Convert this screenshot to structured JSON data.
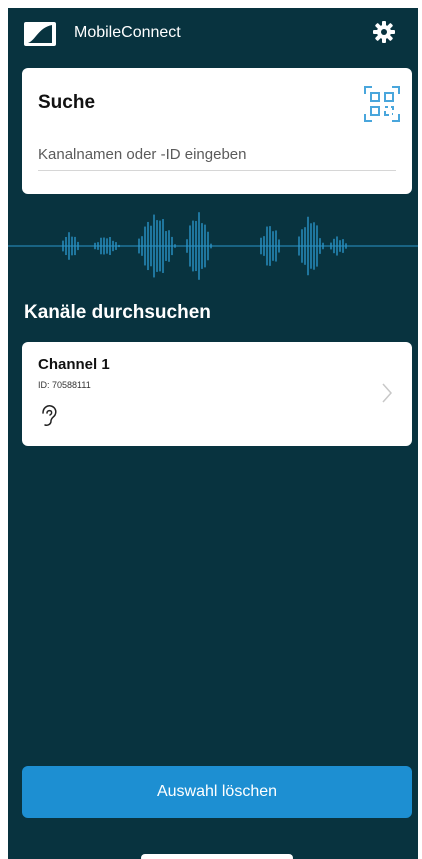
{
  "header": {
    "app_title": "MobileConnect",
    "logo_icon": "sennheiser-logo-icon",
    "settings_icon": "gear-icon"
  },
  "search": {
    "title": "Suche",
    "placeholder": "Kanalnamen oder -ID eingeben",
    "value": "",
    "qr_icon": "qr-code-scan-icon"
  },
  "channels_section": {
    "title": "Kanäle durchsuchen",
    "items": [
      {
        "name": "Channel 1",
        "id_text": "ID: 70588111",
        "icon": "ear-icon",
        "chevron_icon": "chevron-right-icon"
      }
    ]
  },
  "footer": {
    "clear_label": "Auswahl löschen"
  },
  "colors": {
    "background": "#08333f",
    "card": "#ffffff",
    "accent": "#1d8fd2",
    "waveform": "#2a94c8"
  }
}
